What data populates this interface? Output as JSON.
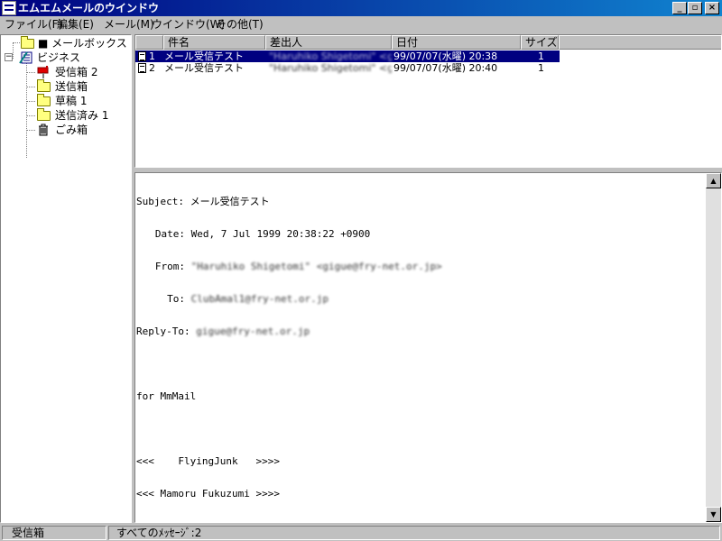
{
  "window": {
    "title": "エムエムメールのウインドウ",
    "minimize": "_",
    "maximize": "▫",
    "close": "×"
  },
  "menu": [
    {
      "label": "ファイル(F)"
    },
    {
      "label": "編集(E)"
    },
    {
      "label": "メール(M)"
    },
    {
      "label": "ウインドウ(W)"
    },
    {
      "label": "その他(T)"
    }
  ],
  "tree": {
    "root": "■ メールボックス",
    "group": "ビジネス",
    "expander": "−",
    "folders": [
      {
        "label": "受信箱 2",
        "icon": "mailbox-icon"
      },
      {
        "label": "送信箱",
        "icon": "folder-icon"
      },
      {
        "label": "草稿 1",
        "icon": "folder-icon"
      },
      {
        "label": "送信済み 1",
        "icon": "folder-icon"
      },
      {
        "label": "ごみ箱",
        "icon": "trash-icon"
      }
    ]
  },
  "list": {
    "columns": [
      "件名",
      "差出人",
      "日付",
      "サイズ"
    ],
    "rows": [
      {
        "num": "1",
        "subject": "メール受信テスト",
        "sender": "\"Haruhiko Shigetomi\" <gi..",
        "date": "99/07/07(水曜) 20:38",
        "size": "1",
        "selected": true
      },
      {
        "num": "2",
        "subject": "メール受信テスト",
        "sender": "\"Haruhiko Shigetomi\" <gi..",
        "date": "99/07/07(水曜) 20:40",
        "size": "1",
        "selected": false
      }
    ]
  },
  "message": {
    "subject_label": "Subject:",
    "subject": "メール受信テスト",
    "date_label": "Date:",
    "date": "Wed, 7 Jul 1999 20:38:22 +0900",
    "from_label": "From:",
    "from": "\"Haruhiko Shigetomi\" <gigue@fry-net.or.jp>",
    "to_label": "To:",
    "to": "ClubAmal1@fry-net.or.jp",
    "replyto_label": "Reply-To:",
    "replyto": "gigue@fry-net.or.jp",
    "body_line1": "for MmMail",
    "sig_line1": "<<<    FlyingJunk   >>>>",
    "sig_line2": "<<< Mamoru Fukuzumi >>>>"
  },
  "status": {
    "folder": "受信箱",
    "info": "すべてのﾒｯｾｰｼﾞ:2"
  }
}
